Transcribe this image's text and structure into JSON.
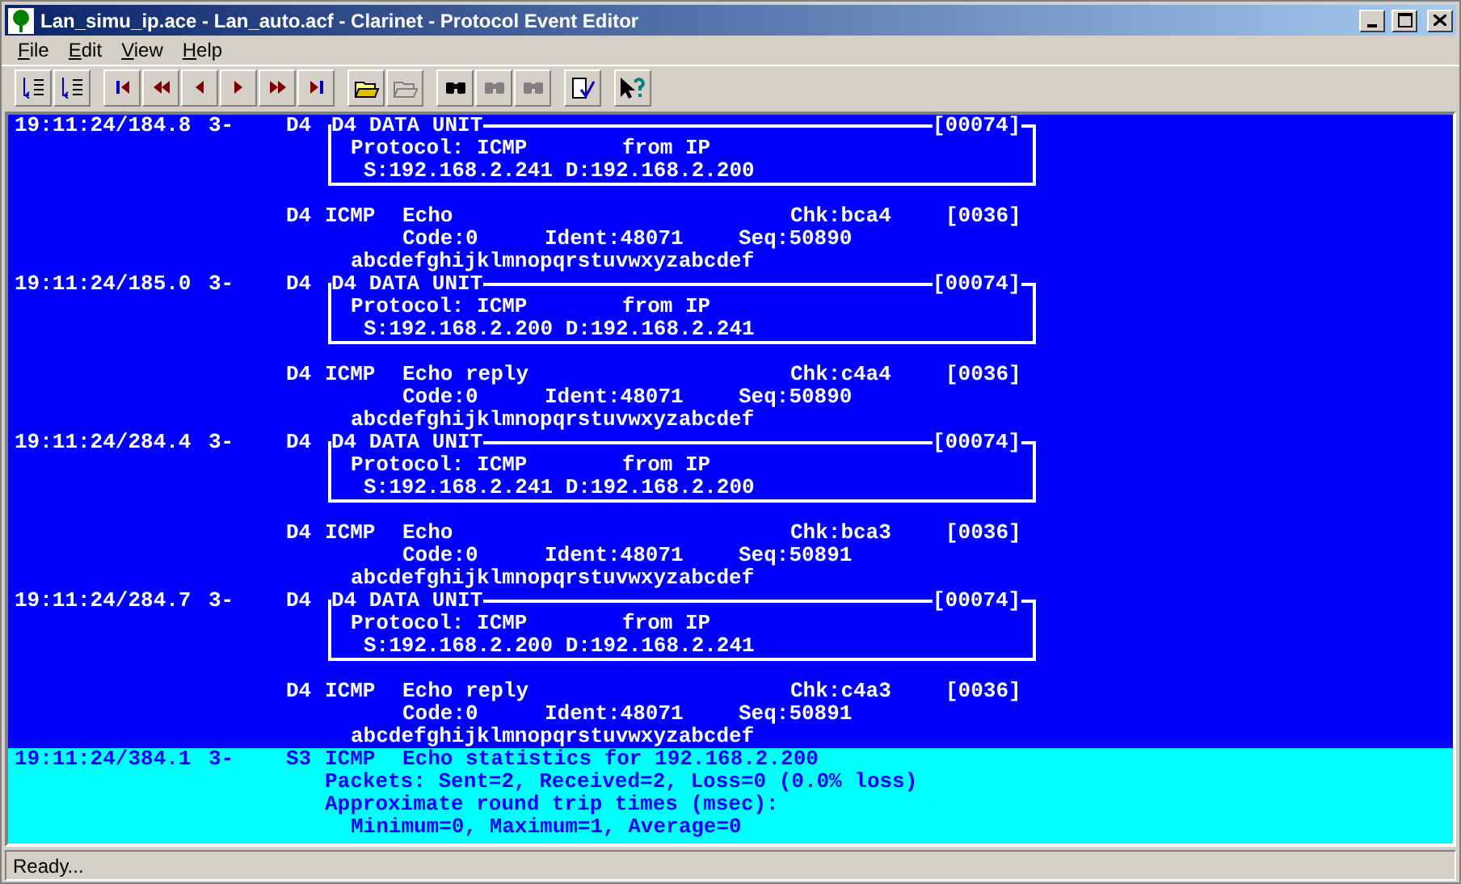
{
  "window": {
    "title": "Lan_simu_ip.ace - Lan_auto.acf - Clarinet - Protocol Event Editor",
    "controls": [
      {
        "kind": "minimize"
      },
      {
        "kind": "maximize"
      },
      {
        "kind": "close"
      }
    ]
  },
  "menu": [
    {
      "label": "File"
    },
    {
      "label": "Edit"
    },
    {
      "label": "View"
    },
    {
      "label": "Help"
    }
  ],
  "toolbar": [
    [
      {
        "kind": "expand",
        "disabled": false
      },
      {
        "kind": "collapse",
        "disabled": false
      }
    ],
    [
      {
        "kind": "first",
        "disabled": false
      },
      {
        "kind": "fast-back",
        "disabled": false
      },
      {
        "kind": "back",
        "disabled": false
      },
      {
        "kind": "forward",
        "disabled": false
      },
      {
        "kind": "fast-forward",
        "disabled": false
      },
      {
        "kind": "last",
        "disabled": false
      }
    ],
    [
      {
        "kind": "open",
        "disabled": false
      },
      {
        "kind": "open-filter",
        "disabled": true
      }
    ],
    [
      {
        "kind": "find",
        "disabled": false
      },
      {
        "kind": "find-prev",
        "disabled": true
      },
      {
        "kind": "find-next",
        "disabled": true
      }
    ],
    [
      {
        "kind": "check",
        "disabled": false
      }
    ],
    [
      {
        "kind": "help",
        "disabled": false
      }
    ]
  ],
  "events": [
    {
      "kind": "data",
      "selected": false,
      "time": "19:11:24/184.8",
      "direction": "3-",
      "layer": "D4",
      "unit": {
        "title": "D4 DATA UNIT",
        "length": "[00074]",
        "protocol": "Protocol: ICMP",
        "source": "from IP",
        "addresses": "S:192.168.2.241 D:192.168.2.200"
      },
      "icmp": {
        "layer": "D4",
        "protocol": "ICMP",
        "type": "Echo",
        "checksum": "Chk:bca4",
        "length": "[0036]",
        "code": "Code:0",
        "ident": "Ident:48071",
        "seq": "Seq:50890",
        "payload": "abcdefghijklmnopqrstuvwxyzabcdef"
      }
    },
    {
      "kind": "data",
      "selected": false,
      "time": "19:11:24/185.0",
      "direction": "3-",
      "layer": "D4",
      "unit": {
        "title": "D4 DATA UNIT",
        "length": "[00074]",
        "protocol": "Protocol: ICMP",
        "source": "from IP",
        "addresses": "S:192.168.2.200 D:192.168.2.241"
      },
      "icmp": {
        "layer": "D4",
        "protocol": "ICMP",
        "type": "Echo reply",
        "checksum": "Chk:c4a4",
        "length": "[0036]",
        "code": "Code:0",
        "ident": "Ident:48071",
        "seq": "Seq:50890",
        "payload": "abcdefghijklmnopqrstuvwxyzabcdef"
      }
    },
    {
      "kind": "data",
      "selected": false,
      "time": "19:11:24/284.4",
      "direction": "3-",
      "layer": "D4",
      "unit": {
        "title": "D4 DATA UNIT",
        "length": "[00074]",
        "protocol": "Protocol: ICMP",
        "source": "from IP",
        "addresses": "S:192.168.2.241 D:192.168.2.200"
      },
      "icmp": {
        "layer": "D4",
        "protocol": "ICMP",
        "type": "Echo",
        "checksum": "Chk:bca3",
        "length": "[0036]",
        "code": "Code:0",
        "ident": "Ident:48071",
        "seq": "Seq:50891",
        "payload": "abcdefghijklmnopqrstuvwxyzabcdef"
      }
    },
    {
      "kind": "data",
      "selected": false,
      "time": "19:11:24/284.7",
      "direction": "3-",
      "layer": "D4",
      "unit": {
        "title": "D4 DATA UNIT",
        "length": "[00074]",
        "protocol": "Protocol: ICMP",
        "source": "from IP",
        "addresses": "S:192.168.2.200 D:192.168.2.241"
      },
      "icmp": {
        "layer": "D4",
        "protocol": "ICMP",
        "type": "Echo reply",
        "checksum": "Chk:c4a3",
        "length": "[0036]",
        "code": "Code:0",
        "ident": "Ident:48071",
        "seq": "Seq:50891",
        "payload": "abcdefghijklmnopqrstuvwxyzabcdef"
      }
    },
    {
      "kind": "statistics",
      "selected": true,
      "time": "19:11:24/384.1",
      "direction": "3-",
      "layer": "S3",
      "protocol": "ICMP",
      "title": "Echo statistics for 192.168.2.200",
      "packets": "Packets: Sent=2, Received=2, Loss=0 (0.0% loss)",
      "times_heading": "Approximate round trip times (msec):",
      "times": "Minimum=0, Maximum=1, Average=0"
    }
  ],
  "status_bar": "Ready..."
}
